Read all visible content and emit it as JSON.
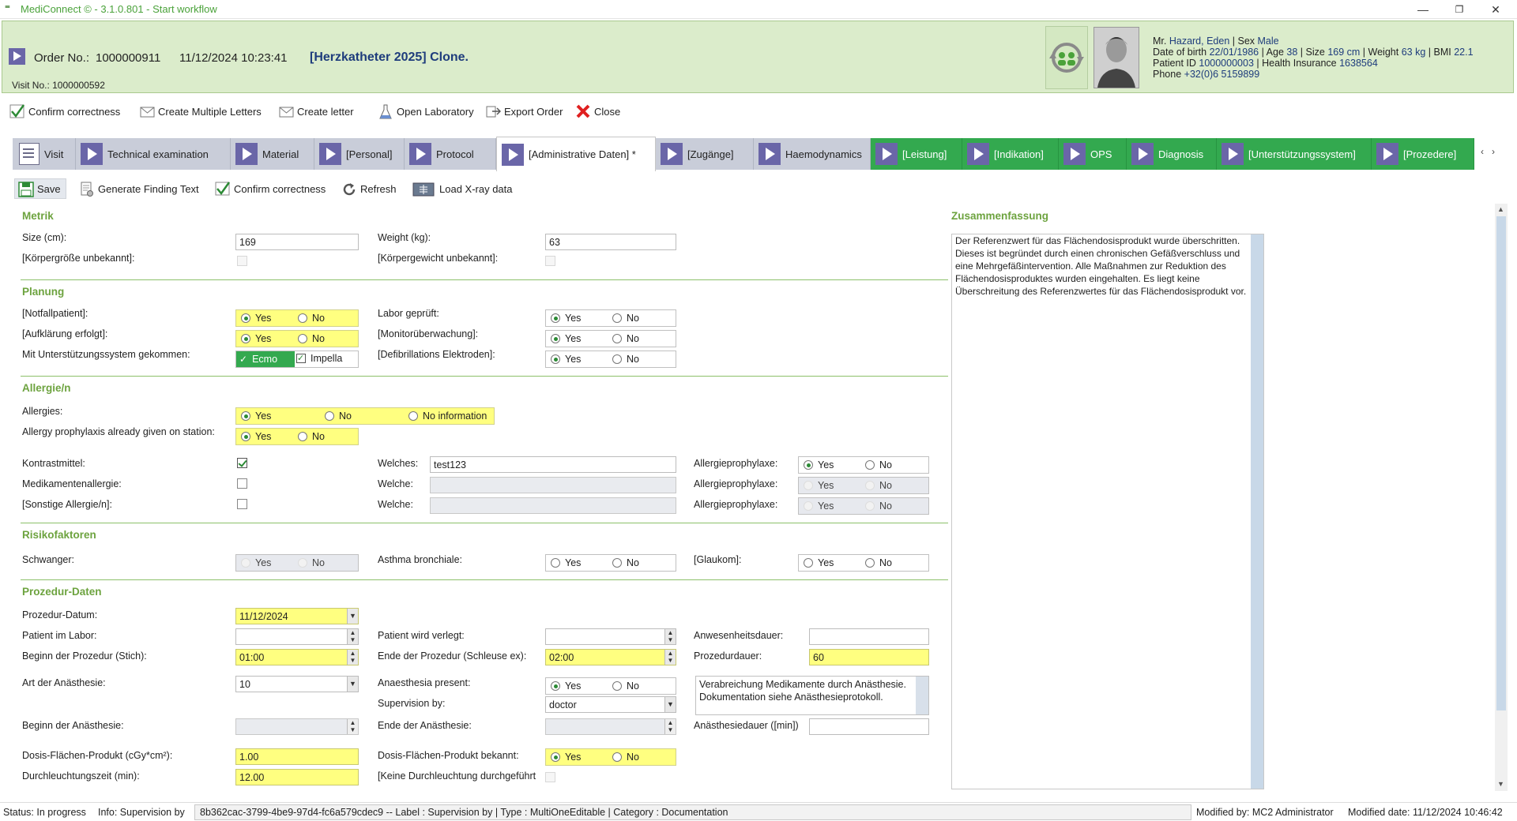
{
  "window": {
    "title": "MediConnect © - 3.1.0.801 - Start workflow"
  },
  "header": {
    "order_label": "Order No.:",
    "order_no": "1000000911",
    "datetime": "11/12/2024 10:23:41",
    "case": "[Herzkatheter 2025] Clone.",
    "visit": "Visit No.: 1000000592",
    "patient": {
      "title": "Mr.",
      "name": "Hazard, Eden",
      "sex_label": "| Sex",
      "sex": "Male",
      "dob_label": "Date of birth",
      "dob": "22/01/1986",
      "age_label": "| Age",
      "age": "38",
      "size_label": "| Size",
      "size": "169 cm",
      "weight_label": "| Weight",
      "weight": "63 kg",
      "bmi_label": "| BMI",
      "bmi": "22.1",
      "pid_label": "Patient ID",
      "pid": "1000000003",
      "ins_label": "| Health Insurance",
      "ins": "1638564",
      "phone_label": "Phone",
      "phone": "+32(0)6 5159899"
    }
  },
  "toolbar1": [
    "Confirm correctness",
    "Create Multiple Letters",
    "Create letter",
    "Open Laboratory",
    "Export Order",
    "Close"
  ],
  "tabs": [
    "Visit",
    "Technical examination",
    "Material",
    "[Personal]",
    "Protocol",
    "[Administrative Daten] *",
    "[Zugänge]",
    "Haemodynamics",
    "[Leistung]",
    "[Indikation]",
    "OPS",
    "Diagnosis",
    "[Unterstützungssystem]",
    "[Prozedere]"
  ],
  "toolbar2": [
    "Save",
    "Generate Finding Text",
    "Confirm correctness",
    "Refresh",
    "Load X-ray data"
  ],
  "sections": {
    "metrik": "Metrik",
    "planung": "Planung",
    "allergie": "Allergie/n",
    "risiko": "Risikofaktoren",
    "prozedur": "Prozedur-Daten",
    "summary": "Zusammenfassung"
  },
  "metrik": {
    "size_label": "Size (cm):",
    "size": "169",
    "weight_label": "Weight (kg):",
    "weight": "63",
    "size_unknown": "[Körpergröße unbekannt]:",
    "weight_unknown": "[Körpergewicht unbekannt]:"
  },
  "planung": {
    "notfall": "[Notfallpatient]:",
    "aufklaerung": "[Aufklärung erfolgt]:",
    "unterstuetzung": "Mit Unterstützungssystem gekommen:",
    "labor": "Labor geprüft:",
    "monitor": "[Monitorüberwachung]:",
    "defi": "[Defibrillations Elektroden]:",
    "ecmo": "Ecmo",
    "impella": "Impella"
  },
  "options": {
    "yes": "Yes",
    "no": "No",
    "noinfo": "No information"
  },
  "allergie": {
    "allergies": "Allergies:",
    "prophylaxis": "Allergy prophylaxis already given on station:",
    "kontrast": "Kontrastmittel:",
    "medikamente": "Medikamentenallergie:",
    "sonstige": "[Sonstige Allergie/n]:",
    "welches": "Welches:",
    "welche": "Welche:",
    "welches_value": "test123",
    "ap": "Allergieprophylaxe:"
  },
  "risiko": {
    "schwanger": "Schwanger:",
    "asthma": "Asthma bronchiale:",
    "glaukom": "[Glaukom]:"
  },
  "prozedur": {
    "datum_label": "Prozedur-Datum:",
    "datum": "11/12/2024",
    "imlabor": "Patient im Labor:",
    "verlegt": "Patient wird verlegt:",
    "anwesenheit": "Anwesenheitsdauer:",
    "beginn_label": "Beginn der Prozedur (Stich):",
    "beginn": "01:00",
    "ende_label": "Ende der Prozedur (Schleuse ex):",
    "ende": "02:00",
    "dauer_label": "Prozedurdauer:",
    "dauer": "60",
    "art_label": "Art der Anästhesie:",
    "art": "10",
    "anaesthesia_present": "Anaesthesia present:",
    "supervision_label": "Supervision by:",
    "supervision": "doctor",
    "anaesthesia_note": "Verabreichung Medikamente durch Anästhesie. Dokumentation siehe Anästhesieprotokoll.",
    "beginn_anae": "Beginn der Anästhesie:",
    "ende_anae": "Ende der Anästhesie:",
    "dauer_anae": "Anästhesiedauer ([min])",
    "dfp_label": "Dosis-Flächen-Produkt (cGy*cm²):",
    "dfp": "1.00",
    "dfp_bekannt": "Dosis-Flächen-Produkt bekannt:",
    "durchleuchtung_label": "Durchleuchtungszeit (min):",
    "durchleuchtung": "12.00",
    "keine_dl": "[Keine Durchleuchtung durchgeführt"
  },
  "summary_text": "Der Referenzwert für das Flächendosisprodukt wurde überschritten. Dieses ist begründet durch einen chronischen Gefäßverschluss und eine Mehrgefäßintervention. Alle Maßnahmen zur Reduktion des Flächendosisproduktes wurden eingehalten. Es liegt keine Überschreitung des Referenzwertes für das Flächendosisprodukt vor.",
  "status": {
    "state": "Status: In progress",
    "info": "Info: Supervision by",
    "detail": "8b362cac-3799-4be9-97d4-fc6a579cdec9  -- Label : Supervision by | Type : MultiOneEditable | Category : Documentation",
    "modified_by": "Modified by: MC2 Administrator",
    "modified_date": "Modified date: 11/12/2024 10:46:42"
  },
  "colors": {
    "accent_green": "#33a94f",
    "header_bg": "#dbeccb",
    "play_purple": "#6a66a8",
    "required_yellow": "#ffff80"
  }
}
